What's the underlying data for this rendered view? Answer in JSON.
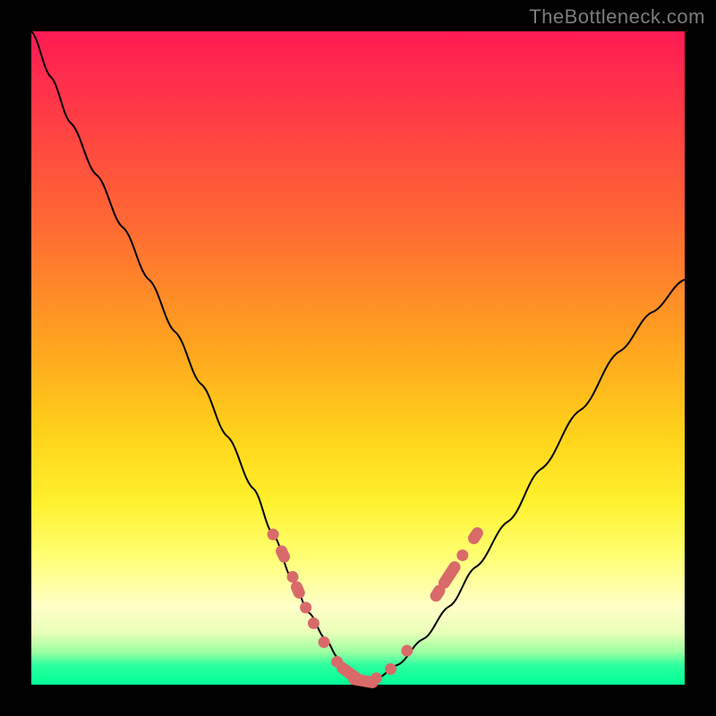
{
  "watermark": "TheBottleneck.com",
  "chart_data": {
    "type": "line",
    "title": "",
    "xlabel": "",
    "ylabel": "",
    "xlim": [
      0,
      1
    ],
    "ylim": [
      0,
      1
    ],
    "series": [
      {
        "name": "curve",
        "x": [
          0.0,
          0.03,
          0.06,
          0.1,
          0.14,
          0.18,
          0.22,
          0.26,
          0.3,
          0.34,
          0.37,
          0.4,
          0.425,
          0.45,
          0.47,
          0.49,
          0.51,
          0.53,
          0.56,
          0.6,
          0.64,
          0.68,
          0.73,
          0.78,
          0.84,
          0.9,
          0.95,
          1.0
        ],
        "y": [
          1.0,
          0.93,
          0.86,
          0.78,
          0.7,
          0.62,
          0.54,
          0.46,
          0.38,
          0.3,
          0.23,
          0.16,
          0.11,
          0.07,
          0.04,
          0.015,
          0.005,
          0.01,
          0.03,
          0.07,
          0.12,
          0.18,
          0.25,
          0.33,
          0.42,
          0.51,
          0.57,
          0.62
        ]
      }
    ],
    "markers": {
      "left_arm": {
        "x": [
          0.37,
          0.385,
          0.4,
          0.408,
          0.42,
          0.432,
          0.448
        ],
        "y": [
          0.23,
          0.2,
          0.165,
          0.145,
          0.118,
          0.094,
          0.065
        ],
        "type": [
          "dot",
          "short",
          "dot",
          "short",
          "dot",
          "dot",
          "dot"
        ]
      },
      "valley_floor": {
        "x": [
          0.468,
          0.488,
          0.508,
          0.528,
          0.55,
          0.575
        ],
        "y": [
          0.035,
          0.017,
          0.006,
          0.01,
          0.024,
          0.052
        ],
        "type": [
          "dot",
          "bar",
          "bar",
          "dot",
          "dot",
          "dot"
        ]
      },
      "right_arm": {
        "x": [
          0.622,
          0.64,
          0.66,
          0.68
        ],
        "y": [
          0.14,
          0.168,
          0.198,
          0.228
        ],
        "type": [
          "short",
          "bar",
          "dot",
          "short"
        ]
      }
    },
    "background_gradient": {
      "top": "#ff1a52",
      "mid": "#ffd41b",
      "bottom": "#00ff96"
    }
  }
}
